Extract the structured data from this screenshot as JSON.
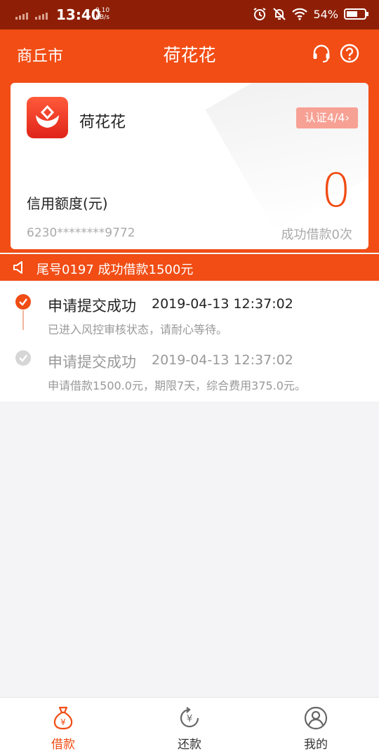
{
  "status_bar": {
    "time": "13:40",
    "speed_value": "0.10",
    "speed_unit": "KB/s",
    "battery": "54%"
  },
  "header": {
    "city": "商丘市",
    "title": "荷花花"
  },
  "card": {
    "app_name": "荷花花",
    "verify_badge": "认证4/4",
    "credit_label": "信用额度(元)",
    "credit_value": "0",
    "card_number": "6230********9772",
    "success_count": "成功借款0次"
  },
  "notice": {
    "text": "尾号0197 成功借款1500元"
  },
  "timeline": [
    {
      "title": "申请提交成功",
      "time": "2019-04-13 12:37:02",
      "desc": "已进入风控审核状态，请耐心等待。",
      "active": true
    },
    {
      "title": "申请提交成功",
      "time": "2019-04-13 12:37:02",
      "desc": "申请借款1500.0元，期限7天，综合费用375.0元。",
      "active": false
    }
  ],
  "bottom_nav": [
    {
      "label": "借款",
      "icon": "money-bag-icon",
      "active": true
    },
    {
      "label": "还款",
      "icon": "repay-icon",
      "active": false
    },
    {
      "label": "我的",
      "icon": "user-icon",
      "active": false
    }
  ],
  "colors": {
    "brand": "#f14d15",
    "status_bar": "#8e1f06",
    "badge": "#f7a195",
    "active_tab": "#f04c14",
    "inactive_tab": "#666666"
  }
}
